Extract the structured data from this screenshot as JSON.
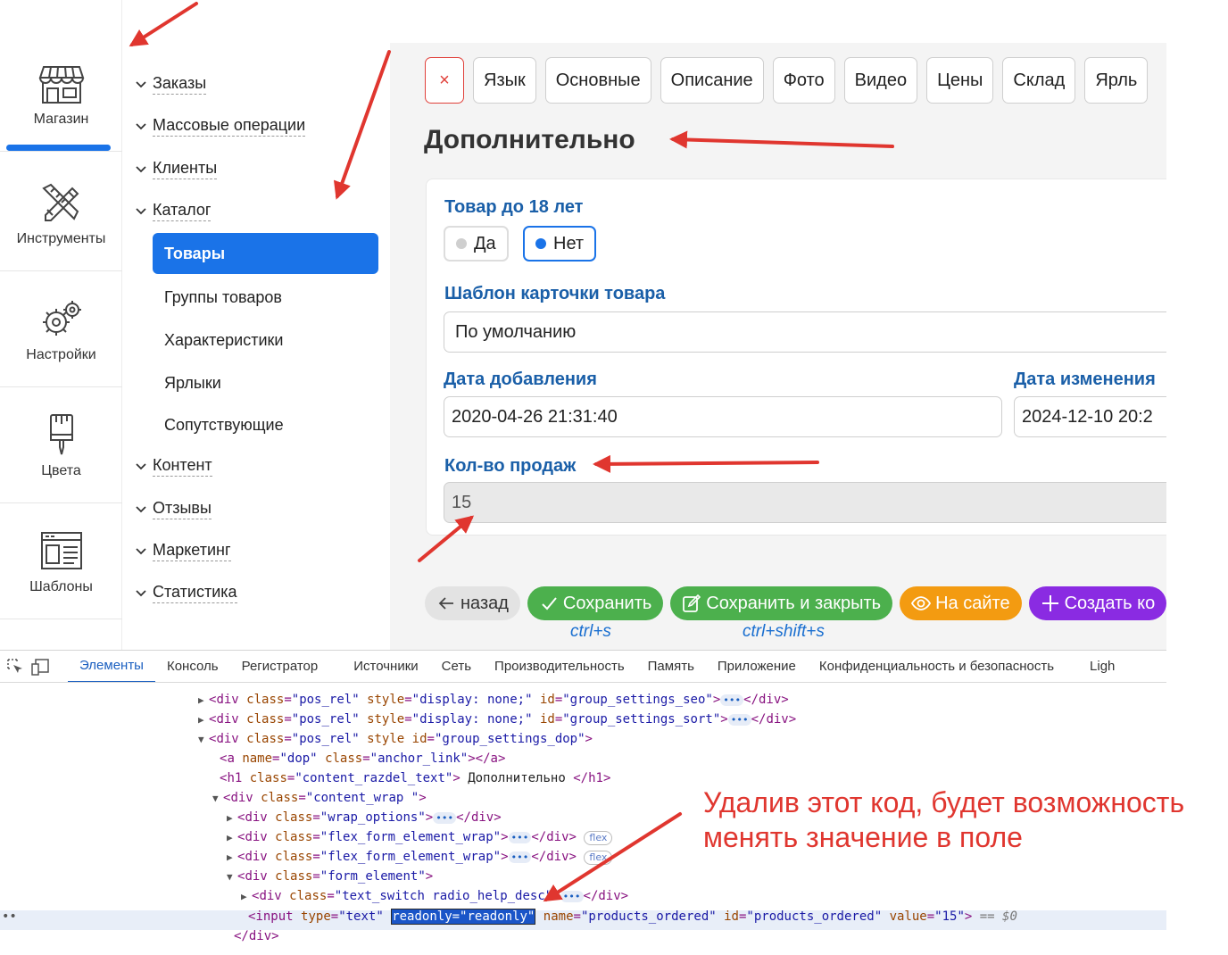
{
  "rail": [
    {
      "label": "Магазин",
      "icon": "shop-icon"
    },
    {
      "label": "Инструменты",
      "icon": "tools-icon"
    },
    {
      "label": "Настройки",
      "icon": "gears-icon"
    },
    {
      "label": "Цвета",
      "icon": "brush-icon"
    },
    {
      "label": "Шаблоны",
      "icon": "template-icon"
    }
  ],
  "menu": {
    "orders": "Заказы",
    "bulk": "Массовые операции",
    "clients": "Клиенты",
    "catalog": "Каталог",
    "products": "Товары",
    "groups": "Группы товаров",
    "features": "Характеристики",
    "labels": "Ярлыки",
    "related": "Сопутствующие",
    "content": "Контент",
    "reviews": "Отзывы",
    "marketing": "Маркетинг",
    "stats": "Статистика"
  },
  "tabs": {
    "close": "×",
    "lang": "Язык",
    "main": "Основные",
    "desc": "Описание",
    "photo": "Фото",
    "video": "Видео",
    "prices": "Цены",
    "stock": "Склад",
    "labels": "Ярль"
  },
  "page_title": "Дополнительно",
  "form": {
    "adult_label": "Товар до 18 лет",
    "adult_yes": "Да",
    "adult_no": "Нет",
    "template_label": "Шаблон карточки товара",
    "template_value": "По умолчанию",
    "date_added_label": "Дата добавления",
    "date_added_value": "2020-04-26 21:31:40",
    "date_changed_label": "Дата изменения",
    "date_changed_value": "2024-12-10 20:2",
    "sales_label": "Кол-во продаж",
    "sales_value": "15"
  },
  "actions": {
    "back": "назад",
    "save": "Сохранить",
    "save_close": "Сохранить и закрыть",
    "on_site": "На сайте",
    "create": "Создать ко",
    "save_hint": "ctrl+s",
    "save_close_hint": "ctrl+shift+s"
  },
  "devtools": {
    "tabs": [
      "Элементы",
      "Консоль",
      "Регистратор",
      "Источники",
      "Сеть",
      "Производительность",
      "Память",
      "Приложение",
      "Конфиденциальность и безопасность",
      "Ligh"
    ],
    "flex_badge": "flex",
    "dots": "•••",
    "row_marker": "••",
    "eq": "== $0",
    "lines": {
      "l1": {
        "tag": "div",
        "a1": "class",
        "v1": "\"pos_rel\"",
        "a2": "style",
        "v2": "\"display: none;\"",
        "a3": "id",
        "v3": "\"group_settings_seo\""
      },
      "l2": {
        "tag": "div",
        "a1": "class",
        "v1": "\"pos_rel\"",
        "a2": "style",
        "v2": "\"display: none;\"",
        "a3": "id",
        "v3": "\"group_settings_sort\""
      },
      "l3": {
        "tag": "div",
        "a1": "class",
        "v1": "\"pos_rel\"",
        "a2": "style",
        "a3": "id",
        "v3": "\"group_settings_dop\""
      },
      "l4": {
        "tag": "a",
        "a1": "name",
        "v1": "\"dop\"",
        "a2": "class",
        "v2": "\"anchor_link\""
      },
      "l5": {
        "tag": "h1",
        "a1": "class",
        "v1": "\"content_razdel_text\"",
        "text": "Дополнительно"
      },
      "l6": {
        "tag": "div",
        "a1": "class",
        "v1": "\"content_wrap \""
      },
      "l7": {
        "tag": "div",
        "a1": "class",
        "v1": "\"wrap_options\""
      },
      "l8": {
        "tag": "div",
        "a1": "class",
        "v1": "\"flex_form_element_wrap\""
      },
      "l9": {
        "tag": "div",
        "a1": "class",
        "v1": "\"flex_form_element_wrap\""
      },
      "l10": {
        "tag": "div",
        "a1": "class",
        "v1": "\"form_element\""
      },
      "l11": {
        "tag": "div",
        "a1": "class",
        "v1": "\"text_switch radio_help_desc\""
      },
      "l12": {
        "tag": "input",
        "a1": "type",
        "v1": "\"text\"",
        "hl": "readonly=\"readonly\"",
        "a2": "name",
        "v2": "\"products_ordered\"",
        "a3": "id",
        "v3": "\"products_ordered\"",
        "a4": "value",
        "v4": "\"15\""
      },
      "l13": {
        "tag": "div"
      }
    }
  },
  "note": {
    "line1": "Удалив этот код, будет возможность",
    "line2": "менять значение в поле"
  },
  "colors": {
    "accent": "#1a73e8",
    "annotation": "#e0362f",
    "save": "#4cb04d",
    "site": "#f39b11",
    "create": "#8a2be2"
  }
}
